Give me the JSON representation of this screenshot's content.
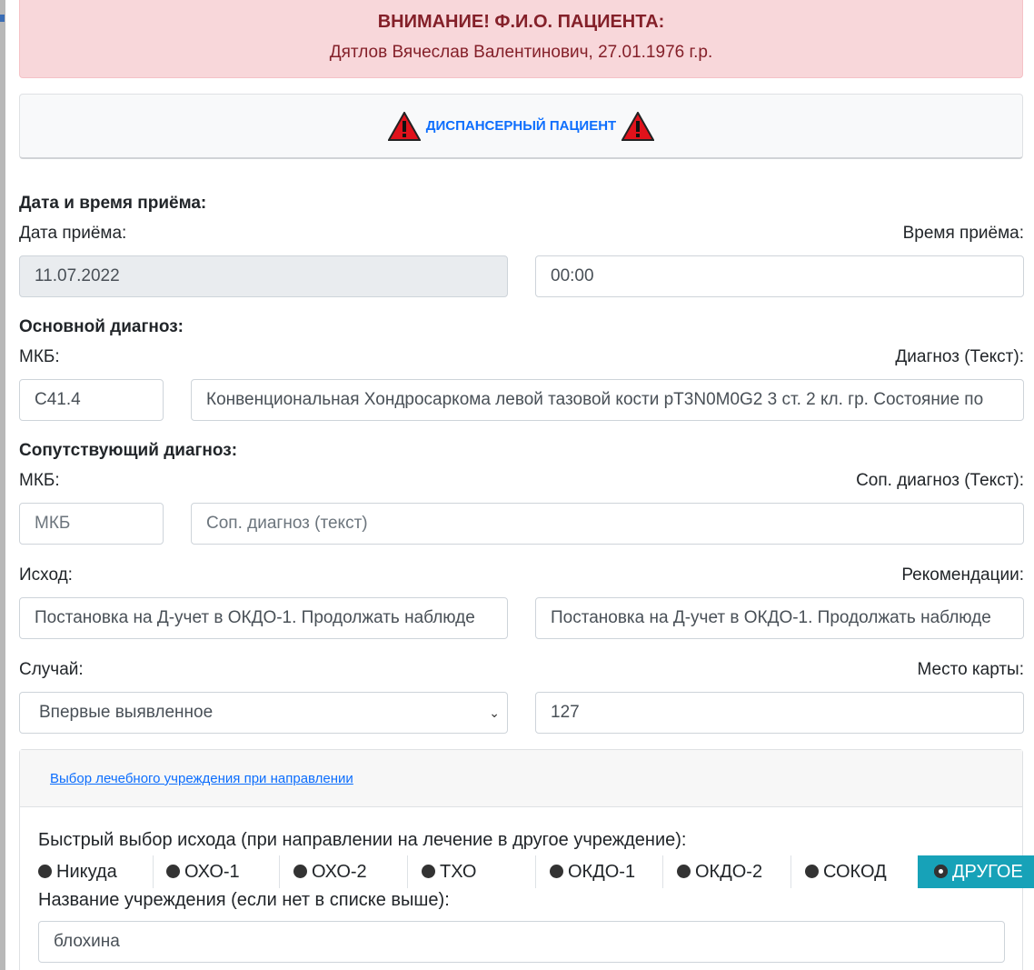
{
  "alert": {
    "title": "ВНИМАНИЕ! Ф.И.О. ПАЦИЕНТА:",
    "patient": "Дятлов Вячеслав Валентинович, 27.01.1976 г.р."
  },
  "dispensary": {
    "label": "ДИСПАНСЕРНЫЙ ПАЦИЕНТ",
    "icon": "warning-triangle-icon"
  },
  "visit": {
    "section": "Дата и время приёма:",
    "date_label": "Дата приёма:",
    "date_value": "11.07.2022",
    "time_label": "Время приёма:",
    "time_value": "00:00"
  },
  "main_diagnosis": {
    "section": "Основной диагноз:",
    "icd_label": "МКБ:",
    "icd_value": "C41.4",
    "text_label": "Диагноз (Текст):",
    "text_value": "Конвенциональная Хондросаркома левой тазовой кости pT3N0M0G2 3 ст. 2 кл. гр. Состояние по"
  },
  "secondary_diagnosis": {
    "section": "Сопутствующий диагноз:",
    "icd_label": "МКБ:",
    "icd_placeholder": "МКБ",
    "text_label": "Соп. диагноз (Текст):",
    "text_placeholder": "Соп. диагноз (текст)"
  },
  "outcome": {
    "label": "Исход:",
    "value": "Постановка на Д-учет в ОКДО-1. Продолжать наблюде",
    "recommend_label": "Рекомендации:",
    "recommend_value": "Постановка на Д-учет в ОКДО-1. Продолжать наблюде"
  },
  "case": {
    "label": "Случай:",
    "value": "Впервые выявленное",
    "card_label": "Место карты:",
    "card_value": "127"
  },
  "referral": {
    "link": "Выбор лечебного учреждения при направлении",
    "quick_label": "Быстрый выбор исхода (при направлении на лечение в другое учреждение):",
    "options": [
      "Никуда",
      "ОХО-1",
      "ОХО-2",
      "ТХО",
      "ОКДО-1",
      "ОКДО-2",
      "СОКОД",
      "ДРУГОЕ"
    ],
    "selected": "ДРУГОЕ",
    "selected_color": "#17a2b8",
    "inst_label": "Название учреждения (если нет в списке выше):",
    "inst_value": "блохина"
  }
}
